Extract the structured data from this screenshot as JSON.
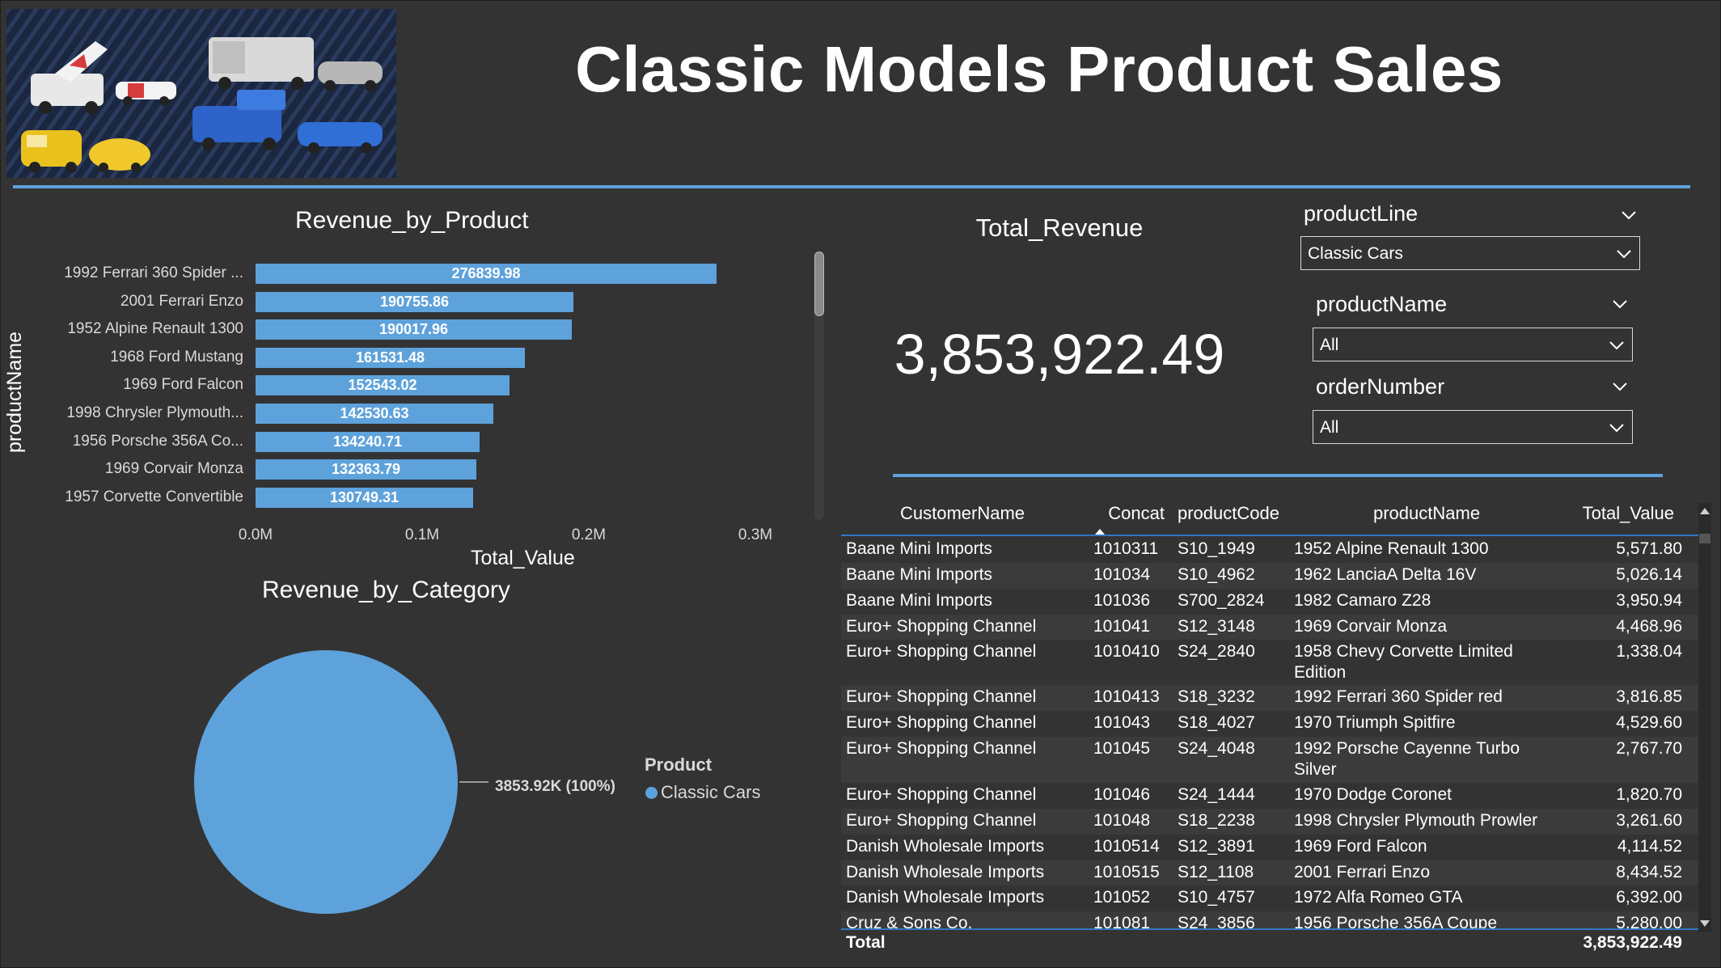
{
  "page": {
    "title": "Classic Models Product Sales"
  },
  "header_image": {
    "icon": "toy-cars-image"
  },
  "colors": {
    "background": "#333333",
    "accent": "#5ea2db",
    "header_rule": "#5ea2db",
    "table_rule": "#2f78c4",
    "text": "#ffffff",
    "muted_text": "#d9d9d9"
  },
  "revenue_by_product": {
    "title": "Revenue_by_Product",
    "xlabel": "Total_Value",
    "ylabel": "productName",
    "ticks": [
      "0.0M",
      "0.1M",
      "0.2M",
      "0.3M"
    ]
  },
  "revenue_by_category": {
    "title": "Revenue_by_Category",
    "slice_label": "3853.92K (100%)",
    "legend_title": "Product",
    "legend_items": [
      "Classic Cars"
    ]
  },
  "chart_data": [
    {
      "type": "bar",
      "title": "Revenue_by_Product",
      "xlabel": "Total_Value",
      "ylabel": "productName",
      "orientation": "horizontal",
      "categories": [
        "1992 Ferrari 360 Spider ...",
        "2001 Ferrari Enzo",
        "1952 Alpine Renault 1300",
        "1968 Ford Mustang",
        "1969 Ford Falcon",
        "1998 Chrysler Plymouth...",
        "1956 Porsche 356A Co...",
        "1969 Corvair Monza",
        "1957 Corvette Convertible"
      ],
      "values": [
        276839.98,
        190755.86,
        190017.96,
        161531.48,
        152543.02,
        142530.63,
        134240.71,
        132363.79,
        130749.31
      ],
      "data_labels": [
        "276839.98",
        "190755.86",
        "190017.96",
        "161531.48",
        "152543.02",
        "142530.63",
        "134240.71",
        "132363.79",
        "130749.31"
      ],
      "xlim": [
        0,
        300000
      ],
      "x_ticks": [
        "0.0M",
        "0.1M",
        "0.2M",
        "0.3M"
      ],
      "grid": false
    },
    {
      "type": "pie",
      "title": "Revenue_by_Category",
      "legend_title": "Product",
      "categories": [
        "Classic Cars"
      ],
      "values": [
        3853922.49
      ],
      "data_labels": [
        "3853.92K (100%)"
      ],
      "colors": [
        "#5ea2db"
      ],
      "legend_position": "right"
    }
  ],
  "card": {
    "title": "Total_Revenue",
    "value": "3,853,922.49"
  },
  "slicers": {
    "product_line": {
      "header": "productLine",
      "value": "Classic Cars"
    },
    "product_name": {
      "header": "productName",
      "value": "All"
    },
    "order_number": {
      "header": "orderNumber",
      "value": "All"
    }
  },
  "table": {
    "columns": [
      "CustomerName",
      "Concat",
      "productCode",
      "productName",
      "Total_Value"
    ],
    "rows": [
      [
        "Baane Mini Imports",
        "1010311",
        "S10_1949",
        "1952 Alpine Renault 1300",
        "5,571.80"
      ],
      [
        "Baane Mini Imports",
        "101034",
        "S10_4962",
        "1962 LanciaA Delta 16V",
        "5,026.14"
      ],
      [
        "Baane Mini Imports",
        "101036",
        "S700_2824",
        "1982 Camaro Z28",
        "3,950.94"
      ],
      [
        "Euro+ Shopping Channel",
        "101041",
        "S12_3148",
        "1969 Corvair Monza",
        "4,468.96"
      ],
      [
        "Euro+ Shopping Channel",
        "1010410",
        "S24_2840",
        "1958 Chevy Corvette Limited Edition",
        "1,338.04"
      ],
      [
        "Euro+ Shopping Channel",
        "1010413",
        "S18_3232",
        "1992 Ferrari 360 Spider red",
        "3,816.85"
      ],
      [
        "Euro+ Shopping Channel",
        "101043",
        "S18_4027",
        "1970 Triumph Spitfire",
        "4,529.60"
      ],
      [
        "Euro+ Shopping Channel",
        "101045",
        "S24_4048",
        "1992 Porsche Cayenne Turbo Silver",
        "2,767.70"
      ],
      [
        "Euro+ Shopping Channel",
        "101046",
        "S24_1444",
        "1970 Dodge Coronet",
        "1,820.70"
      ],
      [
        "Euro+ Shopping Channel",
        "101048",
        "S18_2238",
        "1998 Chrysler Plymouth Prowler",
        "3,261.60"
      ],
      [
        "Danish Wholesale Imports",
        "1010514",
        "S12_3891",
        "1969 Ford Falcon",
        "4,114.52"
      ],
      [
        "Danish Wholesale Imports",
        "1010515",
        "S12_1108",
        "2001 Ferrari Enzo",
        "8,434.52"
      ],
      [
        "Danish Wholesale Imports",
        "101052",
        "S10_4757",
        "1972 Alfa Romeo GTA",
        "6,392.00"
      ],
      [
        "Cruz & Sons Co.",
        "101081",
        "S24_3856",
        "1956 Porsche 356A Coupe",
        "5,280.00"
      ]
    ],
    "total_label": "Total",
    "total_value": "3,853,922.49"
  }
}
